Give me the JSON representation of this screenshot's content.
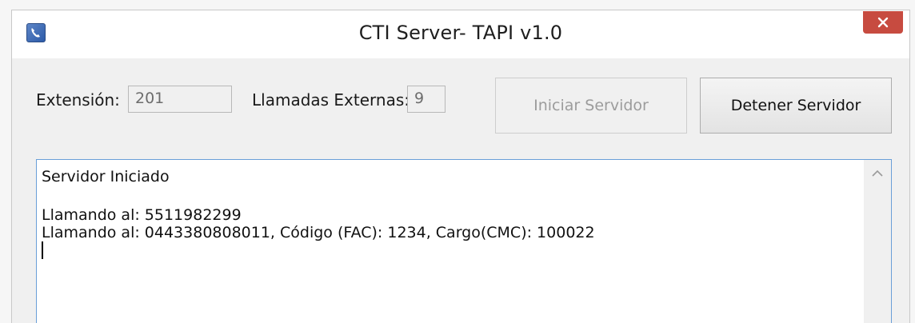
{
  "window": {
    "title": "CTI Server- TAPI  v1.0",
    "icon": "phone-app-icon",
    "close_icon": "close-icon",
    "colors": {
      "close_button": "#c74b40",
      "log_border": "#6a9fd8"
    }
  },
  "form": {
    "extension_label": "Extensión:",
    "extension_value": "201",
    "external_calls_label": "Llamadas Externas:",
    "external_calls_value": "9",
    "start_button_label": "Iniciar Servidor",
    "stop_button_label": "Detener Servidor"
  },
  "log": {
    "lines": [
      "Servidor Iniciado",
      "",
      "Llamando al: 5511982299",
      "Llamando al: 0443380808011,  Código (FAC): 1234,  Cargo(CMC): 100022"
    ],
    "scroll_up_icon": "chevron-up-icon"
  }
}
